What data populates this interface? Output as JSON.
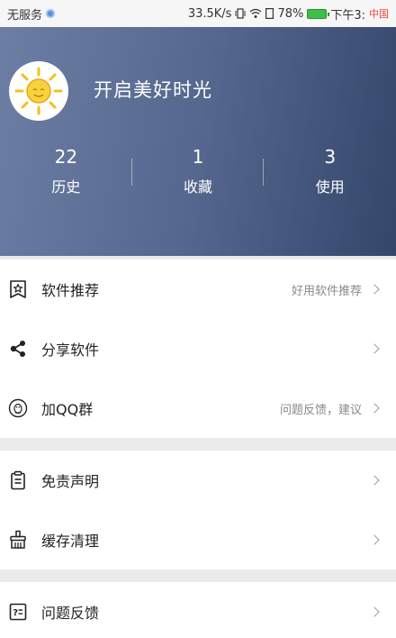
{
  "status_bar": {
    "no_service": "无服务",
    "speed": "33.5K/s",
    "battery": "78%",
    "time": "下午3:",
    "carrier_fragment": "中国"
  },
  "profile": {
    "name": "开启美好时光",
    "stats": [
      {
        "value": "22",
        "label": "历史"
      },
      {
        "value": "1",
        "label": "收藏"
      },
      {
        "value": "3",
        "label": "使用"
      }
    ]
  },
  "menu": {
    "software_recommend": {
      "label": "软件推荐",
      "hint": "好用软件推荐",
      "icon": "star-bookmark-icon"
    },
    "share_software": {
      "label": "分享软件",
      "icon": "share-icon"
    },
    "join_qq_group": {
      "label": "加QQ群",
      "hint": "问题反馈，建议",
      "icon": "qq-penguin-icon"
    },
    "disclaimer": {
      "label": "免责声明",
      "icon": "clipboard-icon"
    },
    "clear_cache": {
      "label": "缓存清理",
      "icon": "broom-icon"
    },
    "feedback": {
      "label": "问题反馈",
      "icon": "question-form-icon"
    }
  },
  "colors": {
    "header_start": "#6c7ea3",
    "header_end": "#35466b",
    "background": "#ebebeb",
    "hint_text": "#8a8a8a"
  }
}
